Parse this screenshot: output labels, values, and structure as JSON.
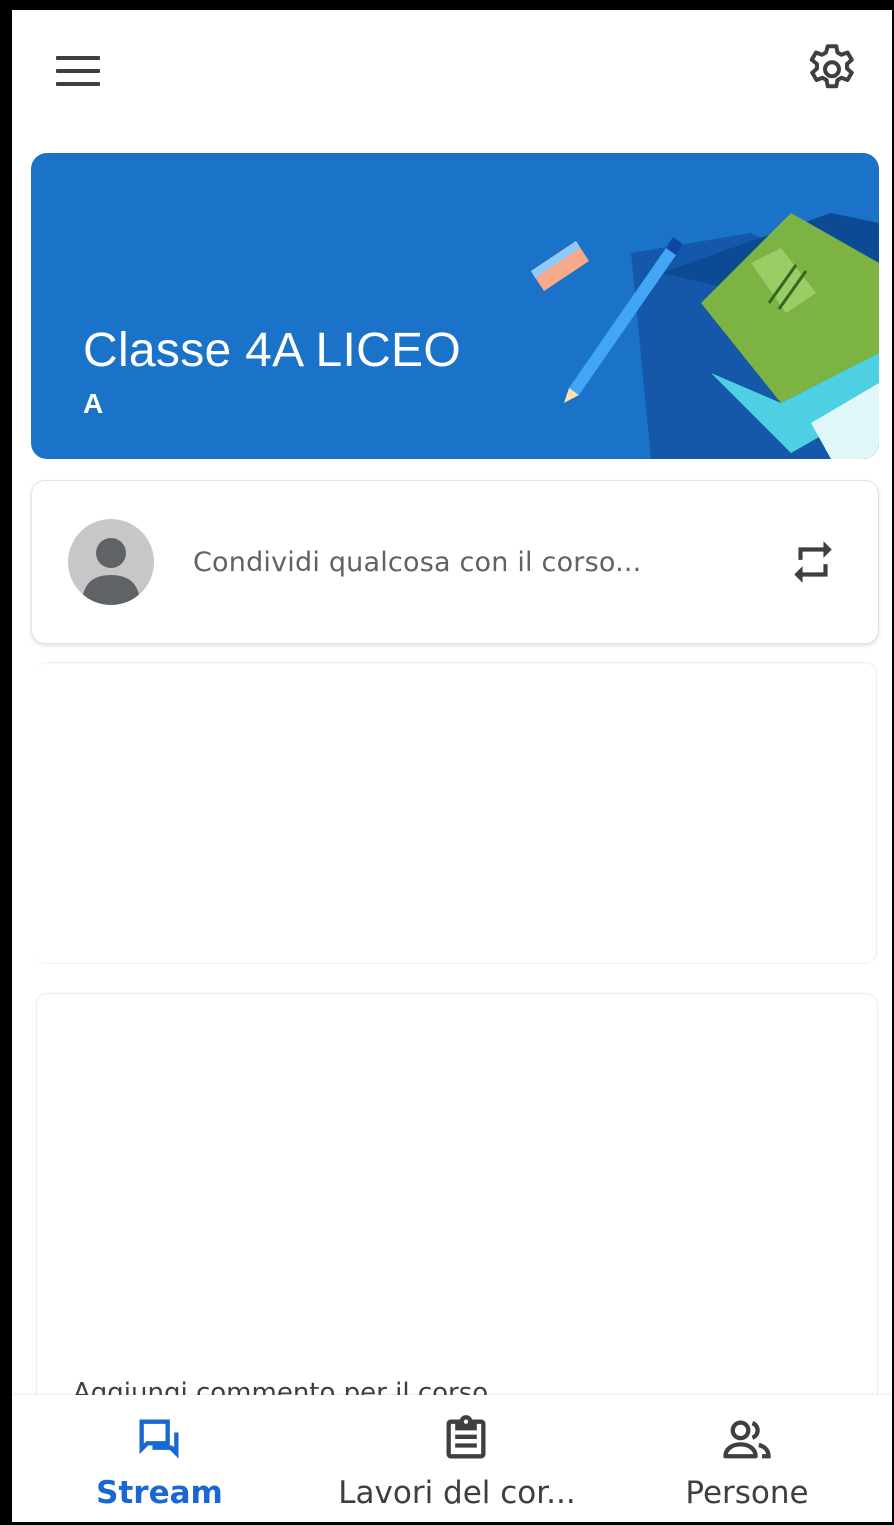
{
  "header": {
    "menu_icon": "hamburger-menu-icon",
    "settings_icon": "gear-icon"
  },
  "class_banner": {
    "title": "Classe 4A LICEO",
    "section": "A",
    "background_color": "#1a73c8"
  },
  "share_box": {
    "placeholder": "Condividi qualcosa con il corso...",
    "avatar_icon": "default-avatar-icon",
    "repost_icon": "repost-icon"
  },
  "posts": [
    {
      "comment_placeholder": ""
    },
    {
      "comment_placeholder": "Aggiungi commento per il corso"
    }
  ],
  "bottom_nav": {
    "items": [
      {
        "label": "Stream",
        "icon": "stream-icon",
        "active": true
      },
      {
        "label": "Lavori del cor...",
        "icon": "classwork-icon",
        "active": false
      },
      {
        "label": "Persone",
        "icon": "people-icon",
        "active": false
      }
    ],
    "active_color": "#1967d2"
  }
}
